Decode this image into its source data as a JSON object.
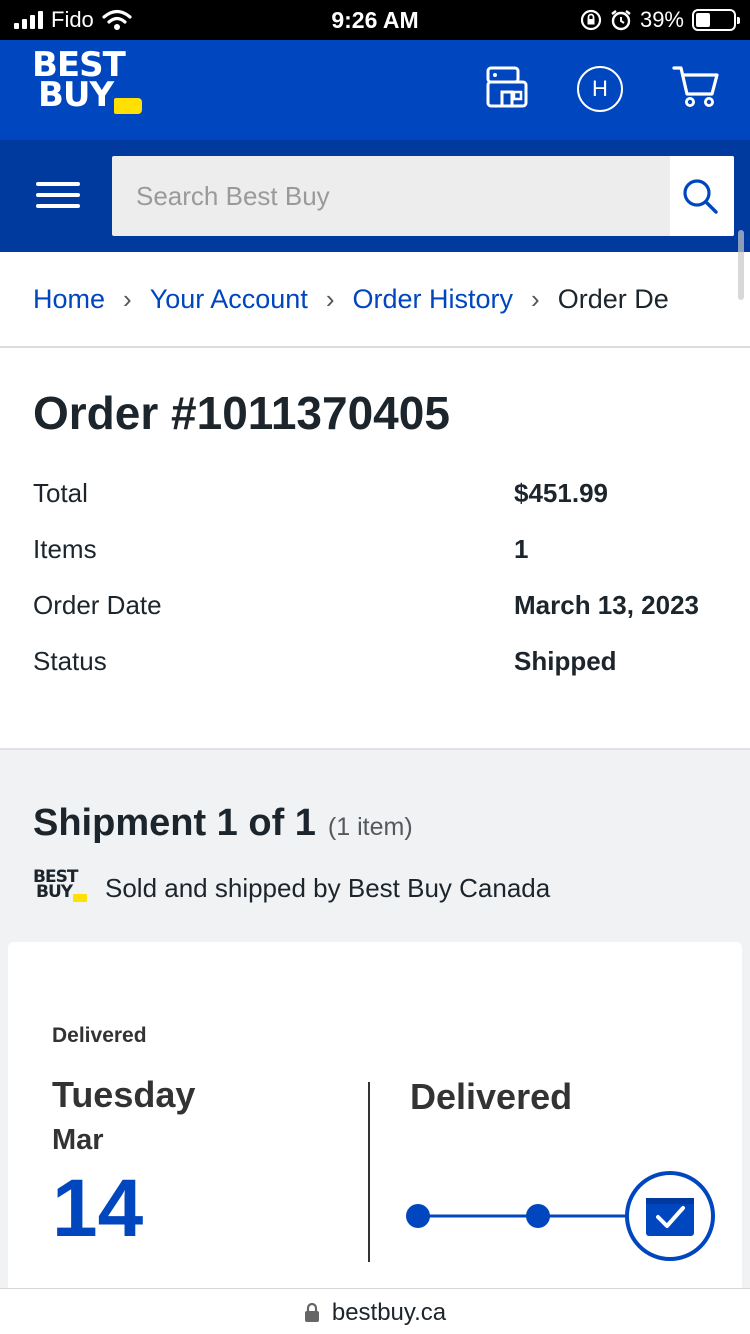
{
  "status_bar": {
    "carrier": "Fido",
    "time": "9:26 AM",
    "battery": "39%",
    "battery_level": 0.39
  },
  "header": {
    "logo_line1": "BEST",
    "logo_line2": "BUY",
    "avatar_initial": "H",
    "icons": [
      "store-icon",
      "account-icon",
      "cart-icon"
    ],
    "brand_color": "#0046be",
    "tag_color": "#ffe000"
  },
  "search": {
    "placeholder": "Search Best Buy"
  },
  "breadcrumb": {
    "items": [
      "Home",
      "Your Account",
      "Order History"
    ],
    "current": "Order De"
  },
  "order": {
    "title": "Order #1011370405",
    "rows": [
      {
        "label": "Total",
        "value": "$451.99"
      },
      {
        "label": "Items",
        "value": "1"
      },
      {
        "label": "Order Date",
        "value": "March 13, 2023"
      },
      {
        "label": "Status",
        "value": "Shipped"
      }
    ]
  },
  "shipment": {
    "title": "Shipment 1 of 1",
    "count": "(1 item)",
    "seller_logo_line1": "BEST",
    "seller_logo_line2": "BUY",
    "seller_text": "Sold and shipped by Best Buy Canada",
    "status_small": "Delivered",
    "day_name": "Tuesday",
    "month": "Mar",
    "day_number": "14",
    "status_big": "Delivered",
    "tracker_steps_completed": 3,
    "tracker_steps_total": 3
  },
  "url_bar": {
    "domain": "bestbuy.ca"
  }
}
